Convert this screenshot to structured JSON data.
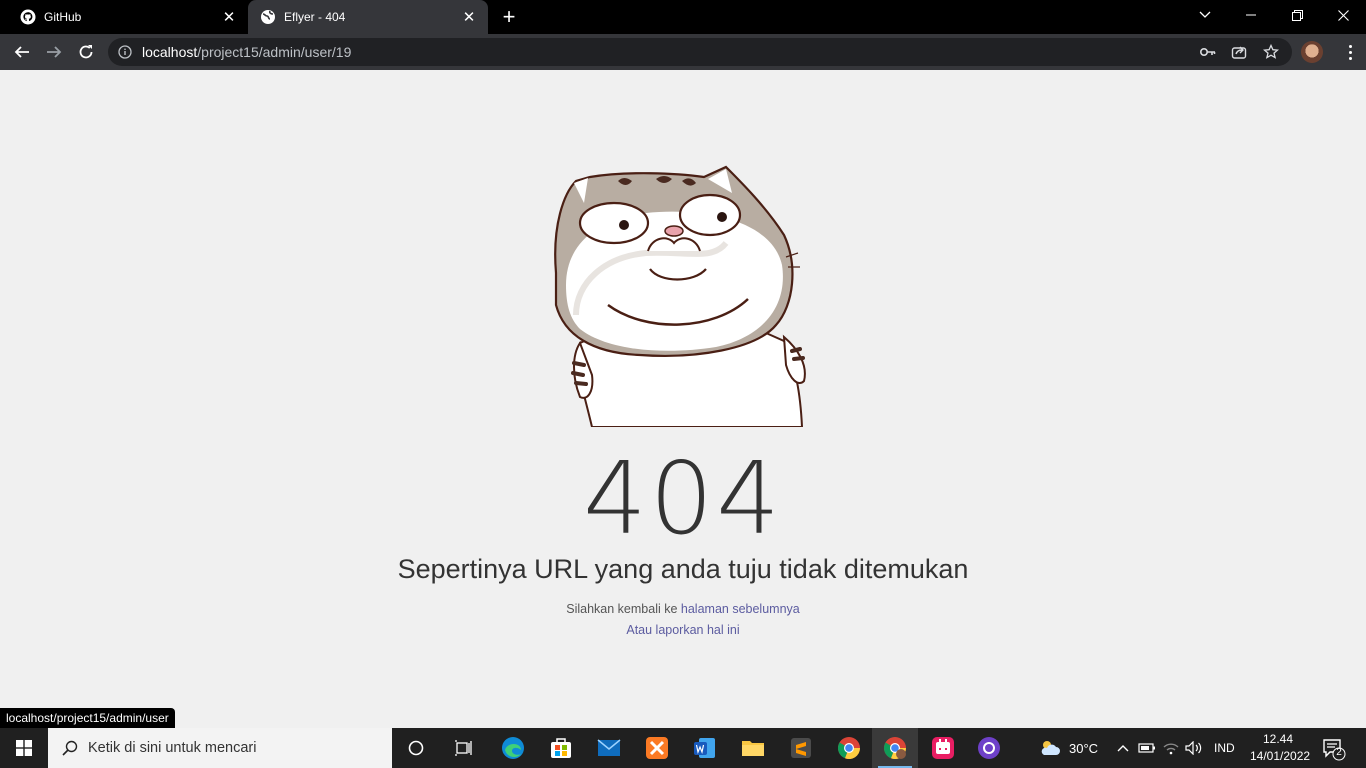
{
  "browser": {
    "tabs": [
      {
        "title": "GitHub",
        "active": false,
        "icon": "github-icon"
      },
      {
        "title": "Eflyer - 404",
        "active": true,
        "icon": "globe-icon"
      }
    ],
    "address": {
      "host": "localhost",
      "path": "/project15/admin/user/19"
    },
    "status_url": "localhost/project15/admin/user"
  },
  "page": {
    "code": "404",
    "message": "Sepertinya URL yang anda tuju tidak ditemukan",
    "back_prefix": "Silahkan kembali ke ",
    "back_link": "halaman sebelumnya",
    "report_link": "Atau laporkan hal ini",
    "link_color": "#5c5ca0"
  },
  "taskbar": {
    "search_placeholder": "Ketik di sini untuk mencari",
    "apps": [
      "task-view-icon",
      "edge-icon",
      "store-icon",
      "mail-icon",
      "xampp-icon",
      "word-icon",
      "file-explorer-icon",
      "sublime-text-icon",
      "chrome-icon",
      "chrome-profile-icon",
      "app-icon",
      "github-desktop-icon"
    ],
    "weather": "30°C",
    "language": "IND",
    "time": "12.44",
    "date": "14/01/2022",
    "notifications": "2"
  }
}
